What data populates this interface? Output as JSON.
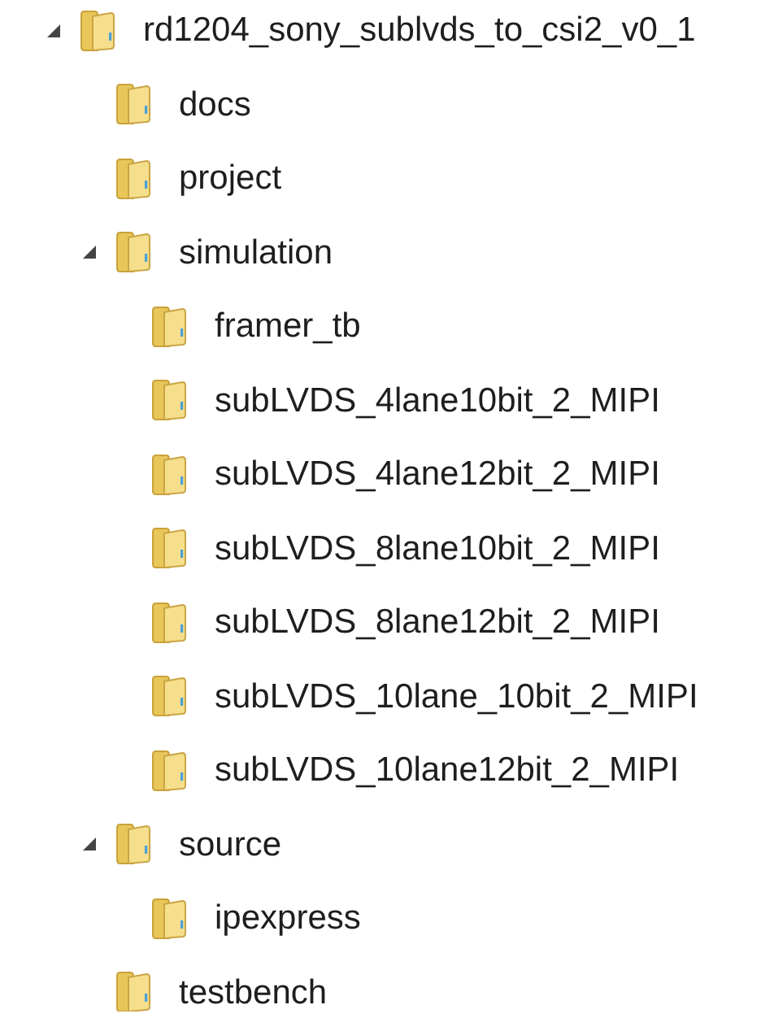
{
  "tree": [
    {
      "label": "rd1204_sony_sublvds_to_csi2_v0_1",
      "expanded": true,
      "children": [
        {
          "label": "docs"
        },
        {
          "label": "project"
        },
        {
          "label": "simulation",
          "expanded": true,
          "children": [
            {
              "label": "framer_tb"
            },
            {
              "label": "subLVDS_4lane10bit_2_MIPI"
            },
            {
              "label": "subLVDS_4lane12bit_2_MIPI"
            },
            {
              "label": "subLVDS_8lane10bit_2_MIPI"
            },
            {
              "label": "subLVDS_8lane12bit_2_MIPI"
            },
            {
              "label": "subLVDS_10lane_10bit_2_MIPI"
            },
            {
              "label": "subLVDS_10lane12bit_2_MIPI"
            }
          ]
        },
        {
          "label": "source",
          "expanded": true,
          "children": [
            {
              "label": "ipexpress"
            }
          ]
        },
        {
          "label": "testbench"
        }
      ]
    }
  ]
}
